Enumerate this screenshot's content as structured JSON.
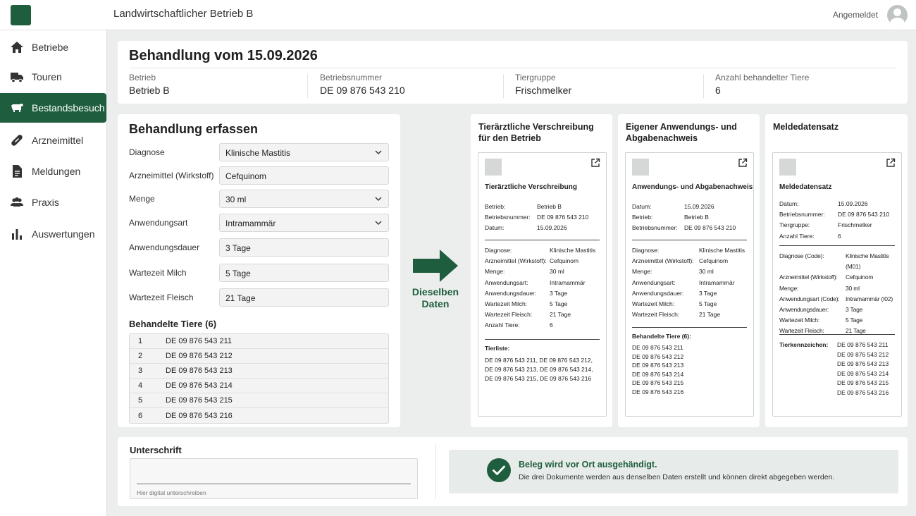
{
  "app": {
    "title": "Landwirtschaftlicher Betrieb B",
    "user_label": "Angemeldet"
  },
  "colors": {
    "accent": "#1e5e3e"
  },
  "sidebar": {
    "items": [
      {
        "label": "Betriebe",
        "icon": "home-icon"
      },
      {
        "label": "Touren",
        "icon": "truck-icon"
      },
      {
        "label": "Bestandsbesuch",
        "icon": "cow-icon",
        "active": true
      },
      {
        "label": "Arzneimittel",
        "icon": "pill-icon"
      },
      {
        "label": "Meldungen",
        "icon": "document-icon"
      },
      {
        "label": "Praxis",
        "icon": "people-icon"
      },
      {
        "label": "Auswertungen",
        "icon": "bar-chart-icon"
      }
    ]
  },
  "header": {
    "title": "Behandlung vom 15.09.2026",
    "fields": [
      {
        "label": "Betrieb",
        "value": "Betrieb B"
      },
      {
        "label": "Betriebsnummer",
        "value": "DE 09 876 543 210"
      },
      {
        "label": "Tiergruppe",
        "value": "Frischmelker"
      },
      {
        "label": "Anzahl behandelter Tiere",
        "value": "6"
      }
    ]
  },
  "form": {
    "title": "Behandlung erfassen",
    "fields": [
      {
        "label": "Diagnose",
        "value": "Klinische Mastitis"
      },
      {
        "label": "Arzneimittel (Wirkstoff)",
        "value": "Cefquinom"
      },
      {
        "label": "Menge",
        "value": "30 ml"
      },
      {
        "label": "Anwendungsart",
        "value": "Intramammär"
      },
      {
        "label": "Anwendungsdauer",
        "value": "3 Tage"
      },
      {
        "label": "Wartezeit Milch",
        "value": "5 Tage"
      },
      {
        "label": "Wartezeit Fleisch",
        "value": "21 Tage"
      }
    ],
    "animals_title": "Behandelte Tiere (6)",
    "animals": [
      {
        "nr": "1",
        "id": "DE 09 876 543 211"
      },
      {
        "nr": "2",
        "id": "DE 09 876 543 212"
      },
      {
        "nr": "3",
        "id": "DE 09 876 543 213"
      },
      {
        "nr": "4",
        "id": "DE 09 876 543 214"
      },
      {
        "nr": "5",
        "id": "DE 09 876 543 215"
      },
      {
        "nr": "6",
        "id": "DE 09 876 543 216"
      }
    ]
  },
  "arrow_label": {
    "line1": "Dieselben",
    "line2": "Daten"
  },
  "doc1": {
    "card_title": "Tierärztliche Verschreibung für den Betrieb",
    "title": "Tierärztliche Verschreibung",
    "head": [
      {
        "k": "Betrieb:",
        "v": "Betrieb B"
      },
      {
        "k": "Betriebsnummer:",
        "v": "DE 09 876 543 210"
      },
      {
        "k": "Datum:",
        "v": "15.09.2026"
      }
    ],
    "body": [
      {
        "k": "Diagnose:",
        "v": "Klinische Mastitis"
      },
      {
        "k": "Arzneimittel (Wirkstoff):",
        "v": "Cefquinom"
      },
      {
        "k": "Menge:",
        "v": "30 ml"
      },
      {
        "k": "Anwendungsart:",
        "v": "Intramammär"
      },
      {
        "k": "Anwendungsdauer:",
        "v": "3 Tage"
      },
      {
        "k": "Wartezeit Milch:",
        "v": "5 Tage"
      },
      {
        "k": "Wartezeit Fleisch:",
        "v": "21 Tage"
      },
      {
        "k": "Anzahl Tiere:",
        "v": "6"
      }
    ],
    "list_title": "Tierliste:",
    "list_lines": [
      "DE 09 876 543 211, DE 09 876 543 212,",
      "DE 09 876 543 213, DE 09 876 543 214,",
      "DE 09 876 543 215, DE 09 876 543 216"
    ]
  },
  "doc2": {
    "card_title": "Eigener Anwendungs- und Abgabenachweis",
    "title": "Anwendungs- und Abgabenachweis",
    "head": [
      {
        "k": "Datum:",
        "v": "15.09.2026"
      },
      {
        "k": "Betrieb:",
        "v": "Betrieb B"
      },
      {
        "k": "Betriebsnummer:",
        "v": "DE 09 876 543 210"
      }
    ],
    "body": [
      {
        "k": "Diagnose:",
        "v": "Klinische Mastitis"
      },
      {
        "k": "Arzneimittel (Wirkstoff):",
        "v": "Cefquinom"
      },
      {
        "k": "Menge:",
        "v": "30 ml"
      },
      {
        "k": "Anwendungsart:",
        "v": "Intramammär"
      },
      {
        "k": "Anwendungsdauer:",
        "v": "3 Tage"
      },
      {
        "k": "Wartezeit Milch:",
        "v": "5 Tage"
      },
      {
        "k": "Wartezeit Fleisch:",
        "v": "21 Tage"
      }
    ],
    "list_title": "Behandelte Tiere (6):",
    "list_lines": [
      "DE 09 876 543 211",
      "DE 09 876 543 212",
      "DE 09 876 543 213",
      "DE 09 876 543 214",
      "DE 09 876 543 215",
      "DE 09 876 543 216"
    ]
  },
  "doc3": {
    "card_title": "Meldedatensatz",
    "title": "Meldedatensatz",
    "head": [
      {
        "k": "Datum:",
        "v": "15.09.2026"
      },
      {
        "k": "Betriebsnummer:",
        "v": "DE 09 876 543 210"
      },
      {
        "k": "Tiergruppe:",
        "v": "Frischmelker"
      },
      {
        "k": "Anzahl Tiere:",
        "v": "6"
      }
    ],
    "body": [
      {
        "k": "Diagnose (Code):",
        "v": "Klinische Mastitis (M01)"
      },
      {
        "k": "Arzneimittel (Wirkstoff):",
        "v": "Cefquinom"
      },
      {
        "k": "Menge:",
        "v": "30 ml"
      },
      {
        "k": "Anwendungsart (Code):",
        "v": "Intramammär (I02)"
      },
      {
        "k": "Anwendungsdauer:",
        "v": "3 Tage"
      },
      {
        "k": "Wartezeit Milch:",
        "v": "5 Tage"
      },
      {
        "k": "Wartezeit Fleisch:",
        "v": "21 Tage"
      }
    ],
    "list_title": "Tierkennzeichen:",
    "list_lines": [
      "DE 09 876 543 211",
      "DE 09 876 543 212",
      "DE 09 876 543 213",
      "DE 09 876 543 214",
      "DE 09 876 543 215",
      "DE 09 876 543 216"
    ]
  },
  "signature": {
    "title": "Unterschrift",
    "hint": "Hier digital unterschreiben"
  },
  "notice": {
    "title": "Beleg wird vor Ort ausgehändigt.",
    "text": "Die drei Dokumente werden aus denselben Daten erstellt und können direkt abgegeben werden."
  }
}
